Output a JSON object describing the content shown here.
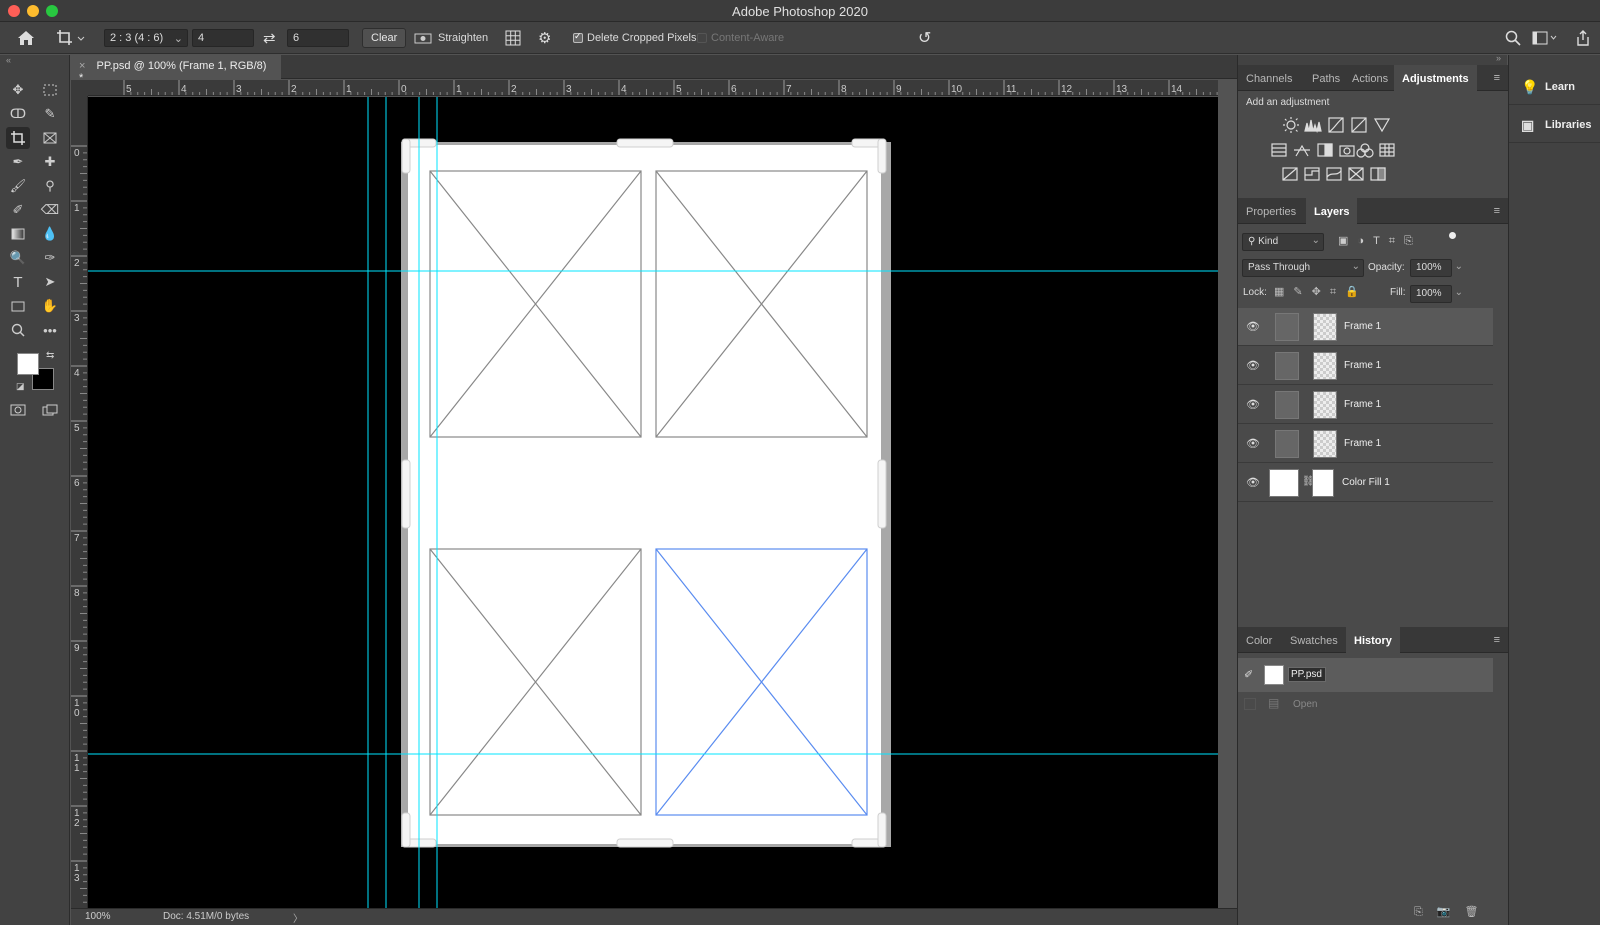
{
  "window": {
    "title": "Adobe Photoshop 2020"
  },
  "options_bar": {
    "ratio_preset": "2 : 3 (4 : 6)",
    "width_value": "4",
    "height_value": "6",
    "clear_label": "Clear",
    "straighten_label": "Straighten",
    "delete_cropped_label": "Delete Cropped Pixels",
    "delete_cropped_checked": true,
    "content_aware_label": "Content-Aware"
  },
  "document": {
    "tab_title": "PP.psd @ 100% (Frame 1, RGB/8) *",
    "close_symbol": "×",
    "zoom": "100%",
    "doc_info": "Doc: 4.51M/0 bytes"
  },
  "rulers": {
    "horizontal": [
      "5",
      "4",
      "3",
      "2",
      "1",
      "0",
      "1",
      "2",
      "3",
      "4",
      "5",
      "6",
      "7",
      "8",
      "9",
      "10",
      "11",
      "12",
      "13",
      "14"
    ],
    "vertical": [
      "0",
      "1",
      "2",
      "3",
      "4",
      "5",
      "6",
      "7",
      "8",
      "9",
      "10",
      "11",
      "12",
      "13"
    ]
  },
  "adjustments_panel": {
    "tabs": [
      "Channels",
      "Paths",
      "Actions",
      "Adjustments"
    ],
    "active_tab": "Adjustments",
    "heading": "Add an adjustment"
  },
  "layers_panel": {
    "tabs": [
      "Properties",
      "Layers"
    ],
    "active_tab": "Layers",
    "filter_label": "Kind",
    "blend_mode": "Pass Through",
    "opacity_label": "Opacity:",
    "opacity_value": "100%",
    "lock_label": "Lock:",
    "fill_label": "Fill:",
    "fill_value": "100%",
    "layers": [
      {
        "name": "Frame 1",
        "selected": true
      },
      {
        "name": "Frame 1",
        "selected": false
      },
      {
        "name": "Frame 1",
        "selected": false
      },
      {
        "name": "Frame 1",
        "selected": false
      },
      {
        "name": "Color Fill 1",
        "selected": false
      }
    ]
  },
  "history_panel": {
    "tabs": [
      "Color",
      "Swatches",
      "History"
    ],
    "active_tab": "History",
    "snapshot_name": "PP.psd",
    "items": [
      "Open"
    ]
  },
  "far_right": {
    "items": [
      "Learn",
      "Libraries"
    ]
  },
  "colors": {
    "guide": "#00e5ff",
    "selected_frame": "#5a8cf0",
    "frame_line": "#888888"
  }
}
